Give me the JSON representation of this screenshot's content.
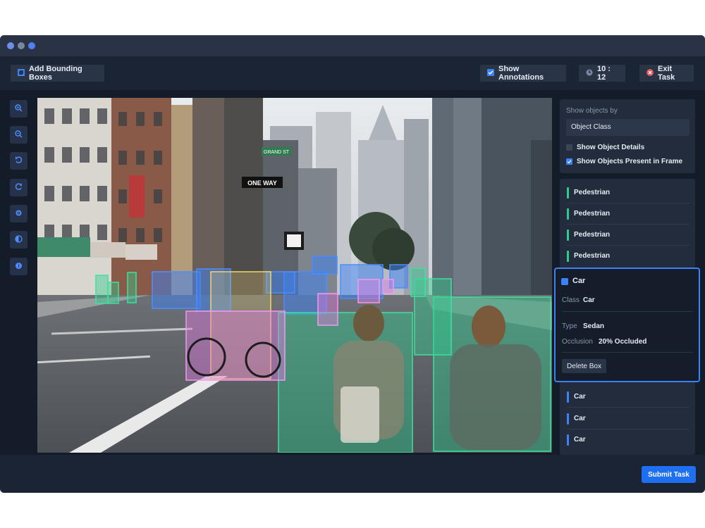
{
  "toolbar": {
    "add_boxes_label": "Add Bounding Boxes",
    "show_annotations_label": "Show Annotations",
    "timer": "10 : 12",
    "exit_label": "Exit Task"
  },
  "tools": [
    {
      "icon": "zoom-in-icon"
    },
    {
      "icon": "zoom-out-icon"
    },
    {
      "icon": "undo-icon"
    },
    {
      "icon": "redo-icon"
    },
    {
      "icon": "settings-icon"
    },
    {
      "icon": "contrast-icon"
    },
    {
      "icon": "info-icon"
    }
  ],
  "photo": {
    "signs": [
      "GRAND ST",
      "ONE WAY"
    ]
  },
  "filter_panel": {
    "heading": "Show objects by",
    "selected": "Object Class",
    "options": [
      {
        "label": "Show Object Details",
        "checked": false
      },
      {
        "label": "Show Objects Present in Frame",
        "checked": true
      }
    ]
  },
  "objects_top": [
    {
      "label": "Pedestrian",
      "color": "#2ecc8f"
    },
    {
      "label": "Pedestrian",
      "color": "#2ecc8f"
    },
    {
      "label": "Pedestrian",
      "color": "#2ecc8f"
    },
    {
      "label": "Pedestrian",
      "color": "#2ecc8f"
    }
  ],
  "selected_object": {
    "title": "Car",
    "color": "#3b82f6",
    "class_label": "Class",
    "class_value": "Car",
    "type_label": "Type",
    "type_value": "Sedan",
    "occlusion_label": "Occlusion",
    "occlusion_value": "20% Occluded",
    "delete_label": "Delete Box"
  },
  "objects_bottom": [
    {
      "label": "Car",
      "color": "#3b82f6"
    },
    {
      "label": "Car",
      "color": "#3b82f6"
    },
    {
      "label": "Car",
      "color": "#3b82f6"
    }
  ],
  "submit_label": "Submit Task",
  "colors": {
    "accent": "#1e6ff1",
    "pedestrian": "#2ecc8f",
    "car": "#3b82f6",
    "cyclist": "#e07be0",
    "bicycle": "#f5d66a"
  }
}
